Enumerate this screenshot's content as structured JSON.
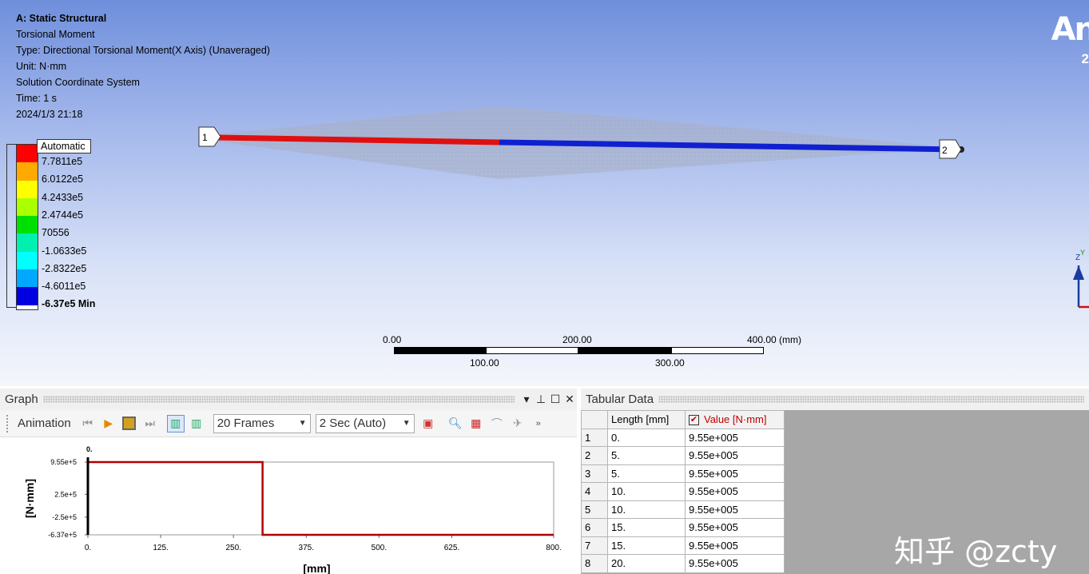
{
  "viewport": {
    "title": "A: Static Structural",
    "lines": [
      "Torsional Moment",
      "Type: Directional Torsional Moment(X Axis) (Unaveraged)",
      "Unit: N·mm",
      "Solution Coordinate System",
      "Time: 1 s",
      "2024/1/3 21:18"
    ],
    "logo": "An",
    "logo_sub": "2",
    "node1": "1",
    "node2": "2",
    "triad_labels": [
      "Z",
      "Y"
    ]
  },
  "legend": {
    "head": "Automatic",
    "colors": [
      "#ff0000",
      "#ffaa00",
      "#ffff00",
      "#aaff00",
      "#00e000",
      "#00f0b0",
      "#00ffff",
      "#00a8ff",
      "#0000e0"
    ],
    "labels": [
      "7.7811e5",
      "6.0122e5",
      "4.2433e5",
      "2.4744e5",
      "70556",
      "-1.0633e5",
      "-2.8322e5",
      "-4.6011e5",
      "-6.37e5 Min"
    ]
  },
  "scale": {
    "top_labels": [
      "0.00",
      "200.00",
      "400.00 (mm)"
    ],
    "bottom_labels": [
      "100.00",
      "300.00"
    ]
  },
  "graph": {
    "title": "Graph",
    "animation_label": "Animation",
    "frames_value": "20 Frames",
    "duration_value": "2 Sec (Auto)",
    "panel_icons": [
      "pin-icon",
      "maximize-icon",
      "close-icon"
    ]
  },
  "chart_data": {
    "type": "line",
    "title": "",
    "xlabel": "[mm]",
    "ylabel": "[N·mm]",
    "xlim": [
      0,
      800
    ],
    "ylim": [
      -637000,
      955000
    ],
    "x_ticks": [
      "0.",
      "125.",
      "250.",
      "375.",
      "500.",
      "625.",
      "800."
    ],
    "y_ticks": [
      "9.55e+5",
      "2.5e+5",
      "-2.5e+5",
      "-6.37e+5"
    ],
    "cursor_label": "0.",
    "series": [
      {
        "x": [
          0,
          300,
          300,
          800
        ],
        "values": [
          955000,
          955000,
          -637000,
          -637000
        ],
        "color": "#b00000"
      }
    ]
  },
  "tabular": {
    "title": "Tabular Data",
    "columns": [
      "Length [mm]",
      "Value [N·mm]"
    ],
    "rows": [
      {
        "n": "1",
        "length": "0.",
        "value": "9.55e+005"
      },
      {
        "n": "2",
        "length": "5.",
        "value": "9.55e+005"
      },
      {
        "n": "3",
        "length": "5.",
        "value": "9.55e+005"
      },
      {
        "n": "4",
        "length": "10.",
        "value": "9.55e+005"
      },
      {
        "n": "5",
        "length": "10.",
        "value": "9.55e+005"
      },
      {
        "n": "6",
        "length": "15.",
        "value": "9.55e+005"
      },
      {
        "n": "7",
        "length": "15.",
        "value": "9.55e+005"
      },
      {
        "n": "8",
        "length": "20.",
        "value": "9.55e+005"
      }
    ],
    "watermark": "知乎 @zcty"
  }
}
